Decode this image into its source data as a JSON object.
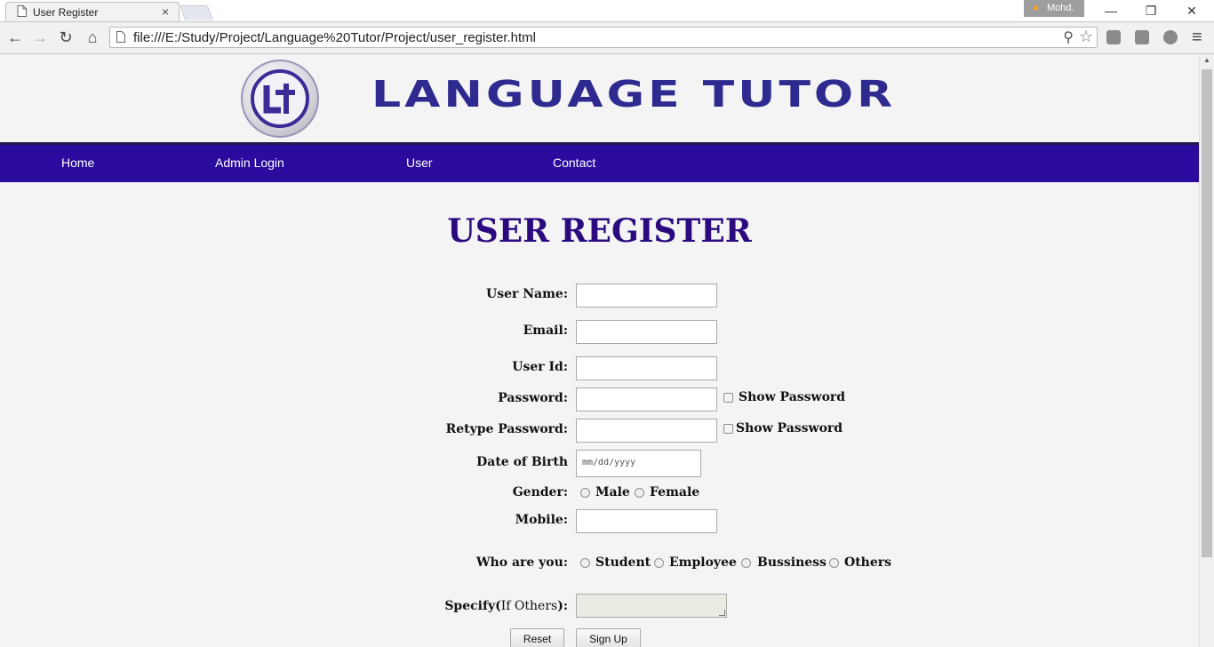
{
  "browser": {
    "tab_title": "User Register",
    "tab_close": "×",
    "profile_name": "Mohd.",
    "url": "file:///E:/Study/Project/Language%20Tutor/Project/user_register.html",
    "window_controls": {
      "minimize": "—",
      "restore": "❐",
      "close": "✕"
    },
    "nav": {
      "back": "←",
      "forward": "→",
      "reload": "↻",
      "home": "⌂"
    }
  },
  "site": {
    "brand": "LANGUAGE TUTOR",
    "nav_links": [
      "Home",
      "Admin Login",
      "User",
      "Contact"
    ]
  },
  "page": {
    "heading": "USER REGISTER"
  },
  "form": {
    "user_name_label": "User Name:",
    "email_label": "Email:",
    "user_id_label": "User Id:",
    "password_label": "Password:",
    "show_password_1": "Show Password",
    "retype_password_label": "Retype Password:",
    "show_password_2": "Show Password",
    "dob_label": "Date of Birth",
    "dob_placeholder": "mm/dd/yyyy",
    "gender_label": "Gender:",
    "gender_options": [
      "Male",
      "Female"
    ],
    "mobile_label": "Mobile:",
    "who_label": "Who are you:",
    "who_options": [
      "Student",
      "Employee",
      "Bussiness",
      "Others"
    ],
    "specify_label_bold1": "Specify(",
    "specify_label_normal": "If Others",
    "specify_label_bold2": "):",
    "reset_button": "Reset",
    "signup_button": "Sign Up"
  },
  "colors": {
    "navbar": "#2b0a9e",
    "heading": "#2b0a80",
    "brand": "#2e2a8f"
  }
}
